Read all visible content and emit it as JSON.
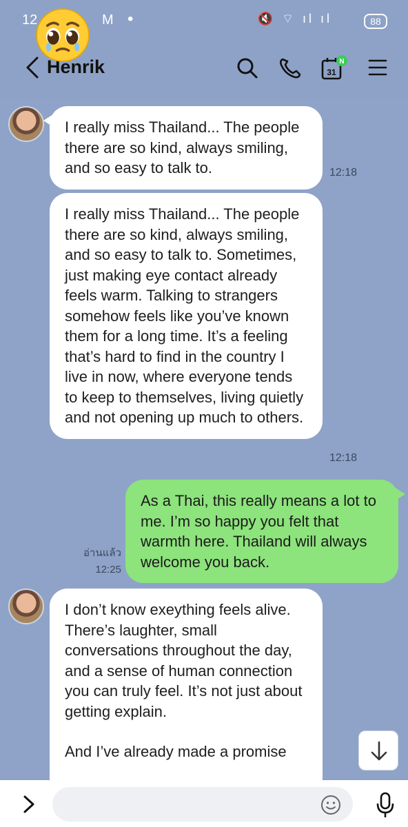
{
  "status": {
    "time": "12",
    "mail_letter": "M",
    "dot": "•",
    "battery": "88"
  },
  "header": {
    "contact_name": "Henrik",
    "calendar_day": "31",
    "calendar_badge": "N"
  },
  "messages": [
    {
      "sender": "them",
      "text": "I really miss Thailand... The people there are so kind, always smiling, and so easy to talk to.",
      "time": "12:18"
    },
    {
      "sender": "them",
      "text": "I really miss Thailand... The people there are so kind, always smiling, and so easy to talk to. Sometimes, just making eye contact already feels warm. Talking to strangers somehow feels like you’ve known them for a long time. It’s a feeling that’s hard to find in the country I live in now, where everyone tends to keep to themselves, living quietly and not opening up much to others.",
      "time": "12:18"
    },
    {
      "sender": "me",
      "text": "As a Thai, this really means a lot to me. I’m so happy you felt that warmth here. Thailand will always welcome you back.",
      "read_label": "อ่านแล้ว",
      "time": "12:25"
    },
    {
      "sender": "them",
      "text": "I don’t know exeything feels alive. There’s laughter, small conversations throughout the day, and a sense of human connection you can truly feel. It’s not just about getting explain.",
      "text_2": "And I’ve already made a promise"
    }
  ],
  "input": {
    "placeholder": ""
  },
  "colors": {
    "chat_background": "#8fa3c8",
    "incoming_bubble": "#ffffff",
    "outgoing_bubble": "#8de37c"
  },
  "icons": [
    "back-icon",
    "search-icon",
    "phone-icon",
    "calendar-icon",
    "menu-icon",
    "chevron-right-icon",
    "smile-icon",
    "microphone-icon",
    "arrow-down-icon"
  ]
}
